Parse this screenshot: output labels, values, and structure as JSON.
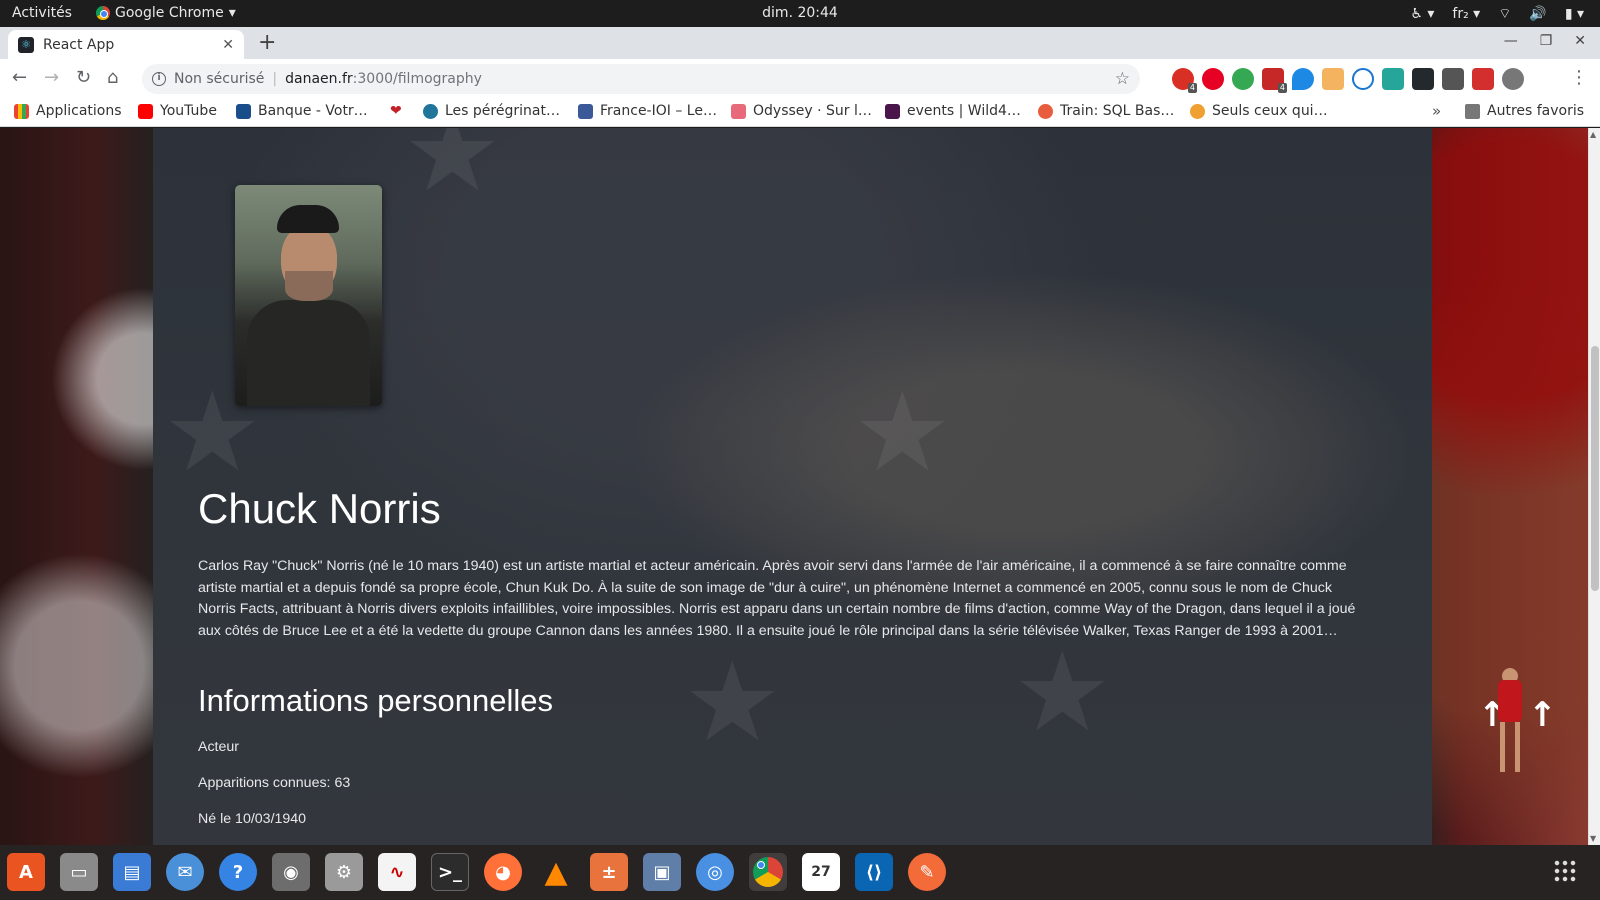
{
  "system_bar": {
    "activities": "Activités",
    "app_name": "Google Chrome",
    "clock": "dim. 20:44",
    "keyboard_layout": "fr₂"
  },
  "browser": {
    "tab_title": "React App",
    "security_label": "Non sécurisé",
    "url_host": "danaen.fr",
    "url_rest": ":3000/filmography",
    "extension_badges": [
      "4",
      "4"
    ],
    "bookmarks": [
      {
        "label": "Applications",
        "color": "#ea4335"
      },
      {
        "label": "YouTube",
        "color": "#ff0000"
      },
      {
        "label": "Banque - Votr…",
        "color": "#1a4e8a"
      },
      {
        "label": "",
        "color": "#c4202a"
      },
      {
        "label": "Les pérégrinat…",
        "color": "#21759b"
      },
      {
        "label": "France-IOI – Le…",
        "color": "#3b5998"
      },
      {
        "label": "Odyssey · Sur l…",
        "color": "#e86a7a"
      },
      {
        "label": "events | Wild4…",
        "color": "#4a154b"
      },
      {
        "label": "Train: SQL Bas…",
        "color": "#e85d3d"
      },
      {
        "label": "Seuls ceux qui…",
        "color": "#f0a030"
      }
    ],
    "bookmarks_more": "»",
    "other_bookmarks": "Autres favoris"
  },
  "page": {
    "name": "Chuck Norris",
    "bio": "Carlos Ray \"Chuck\" Norris (né le 10 mars 1940) est un artiste martial et acteur américain. Après avoir servi dans l'armée de l'air américaine, il a commencé à se faire connaître comme artiste martial et a depuis fondé sa propre école, Chun Kuk Do. À la suite de son image de \"dur à cuire\", un phénomène Internet a commencé en 2005, connu sous le nom de Chuck Norris Facts, attribuant à Norris divers exploits infaillibles, voire impossibles. Norris est apparu dans un certain nombre de films d'action, comme Way of the Dragon, dans lequel il a joué aux côtés de Bruce Lee et a été la vedette du groupe Cannon dans les années 1980. Il a ensuite joué le rôle principal dans la série télévisée Walker, Texas Ranger de 1993 à 2001…",
    "info_heading": "Informations personnelles",
    "role": "Acteur",
    "appearances": "Apparitions connues: 63",
    "birth": "Né le 10/03/1940"
  },
  "dock": {
    "calendar_day": "27"
  }
}
